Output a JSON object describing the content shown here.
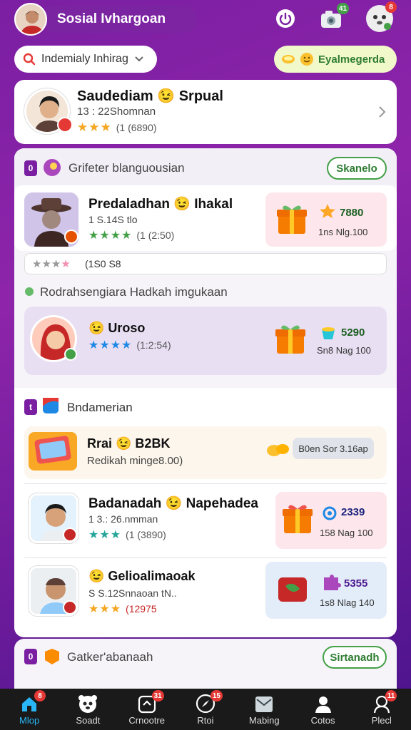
{
  "header": {
    "app_title": "Sosial Ivhargoan",
    "notifications_badge": "41",
    "profile_badge": "8"
  },
  "search": {
    "label": "Indemialy Inhirag"
  },
  "coins": {
    "label": "Eyalmegerda"
  },
  "profile_card": {
    "name": "Saudediam 😉 Srpual",
    "subtitle": "13 : 22Shomnan",
    "rating_meta": "(1 (6890)"
  },
  "section1": {
    "tag": "0",
    "title": "Grifeter blanguousian",
    "action_label": "Skanelo",
    "item": {
      "name": "Predaladhan 😉 Ihakal",
      "subtitle": "1 S.14S tlo",
      "rating_meta": "(1 (2:50)",
      "gift_value": "7880",
      "gift_sub": "1ns Nlg.100"
    },
    "mini_bar_text": "(1S0 S8"
  },
  "section1b": {
    "title": "Rodrahsengiara Hadkah imgukaan",
    "item": {
      "name": "😉 Uroso",
      "rating_meta": "(1:2:54)",
      "gift_value": "5290",
      "gift_sub": "Sn8 Nag 100"
    }
  },
  "section2": {
    "tag": "t",
    "title": "Bndamerian",
    "promo": {
      "title": "Rrai 😉 B2BK",
      "subtitle": "Redikah minge8.00)",
      "pill": "B0en Sor 3.16ap"
    },
    "items": [
      {
        "name": "Badanadah 😉 Napehadea",
        "subtitle": "1 3.: 26.nmman",
        "rating_meta": "(1 (3890)",
        "gift_value": "2339",
        "gift_sub": "158 Nag 100"
      },
      {
        "name": "😉 Gelioalimaoak",
        "subtitle": "S S.12Snnaoan  tN..",
        "rating_meta": "(12975",
        "gift_value": "5355",
        "gift_sub": "1s8 Nlag 140"
      }
    ]
  },
  "section3": {
    "tag": "0",
    "title": "Gatker'abanaah",
    "action_label": "Sirtanadh"
  },
  "bottom_nav": [
    {
      "label": "Mlop",
      "badge": "8",
      "icon": "home-icon",
      "active": true
    },
    {
      "label": "Soadt",
      "badge": "",
      "icon": "panda-icon"
    },
    {
      "label": "Crnootre",
      "badge": "31",
      "icon": "media-icon"
    },
    {
      "label": "Rtoi",
      "badge": "15",
      "icon": "compass-icon"
    },
    {
      "label": "Mabing",
      "badge": "",
      "icon": "mail-icon"
    },
    {
      "label": "Cotos",
      "badge": "",
      "icon": "person-icon"
    },
    {
      "label": "Plecl",
      "badge": "11",
      "icon": "user-icon"
    }
  ],
  "colors": {
    "accent_purple": "#7b1fa2",
    "accent_green": "#43a047",
    "star": "#f5a623",
    "nav_active": "#29b6f6"
  }
}
